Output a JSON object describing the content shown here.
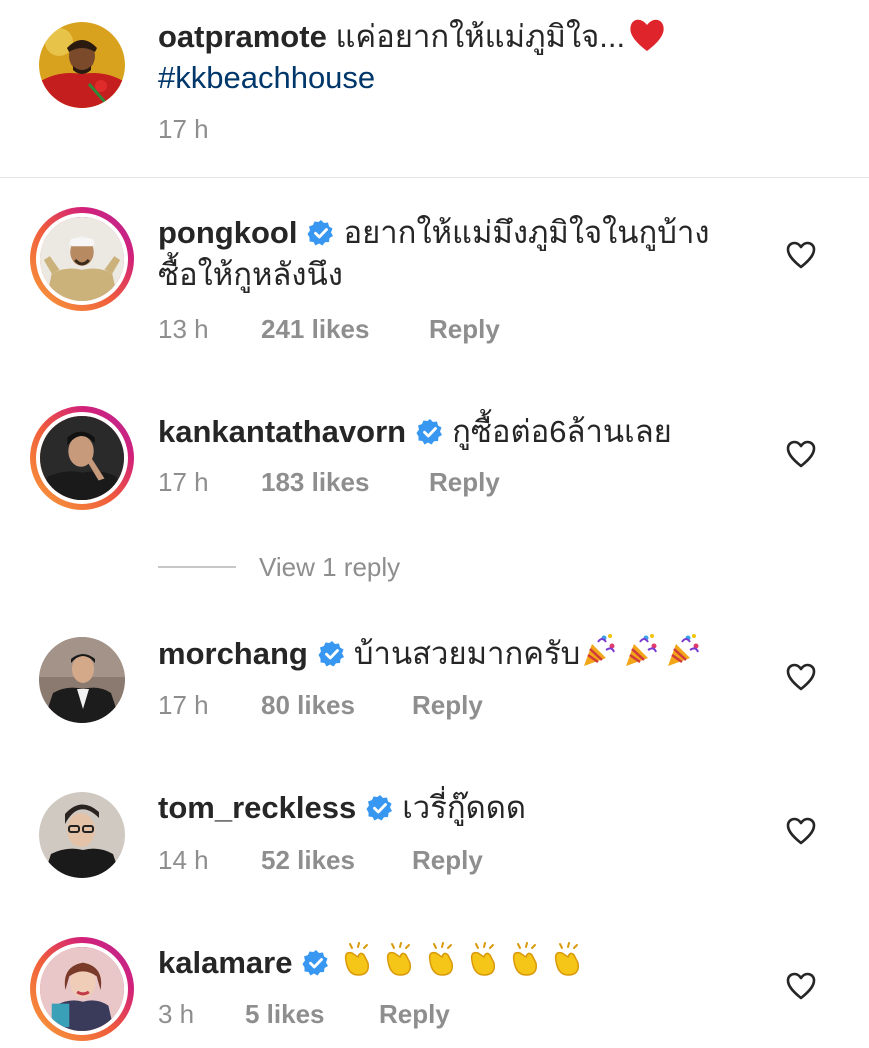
{
  "caption": {
    "username": "oatpramote",
    "text": "แค่อยากให้แม่ภูมิใจ...",
    "hashtag": "#kkbeachhouse",
    "time": "17 h",
    "emoji_icon": "red-heart-emoji"
  },
  "comments": [
    {
      "username": "pongkool",
      "verified": true,
      "text_line1": "อยากให้แม่มึงภูมิใจในกูบ้าง",
      "text_line2": "ซื้อให้กูหลังนึง",
      "time": "13 h",
      "likes": "241 likes",
      "reply": "Reply",
      "story_ring": true
    },
    {
      "username": "kankantathavorn",
      "verified": true,
      "text_line1": "กูซื้อต่อ6ล้านเลย",
      "time": "17 h",
      "likes": "183 likes",
      "reply": "Reply",
      "story_ring": true,
      "view_replies": "View 1 reply"
    },
    {
      "username": "morchang",
      "verified": true,
      "text_line1": "บ้านสวยมากครับ",
      "emoji": "party-popper-emoji",
      "emoji_count": 3,
      "time": "17 h",
      "likes": "80 likes",
      "reply": "Reply",
      "story_ring": false
    },
    {
      "username": "tom_reckless",
      "verified": true,
      "text_line1": "เวรี่กู๊ดดด",
      "time": "14 h",
      "likes": "52 likes",
      "reply": "Reply",
      "story_ring": false
    },
    {
      "username": "kalamare",
      "verified": true,
      "text_line1": "",
      "emoji": "clapping-hands-emoji",
      "emoji_count": 6,
      "time": "3 h",
      "likes": "5 likes",
      "reply": "Reply",
      "story_ring": true
    }
  ],
  "colors": {
    "verified_blue": "#3897f0",
    "hashtag_blue": "#00376b",
    "meta_gray": "#8e8e8e",
    "heart_red": "#e0242b"
  }
}
